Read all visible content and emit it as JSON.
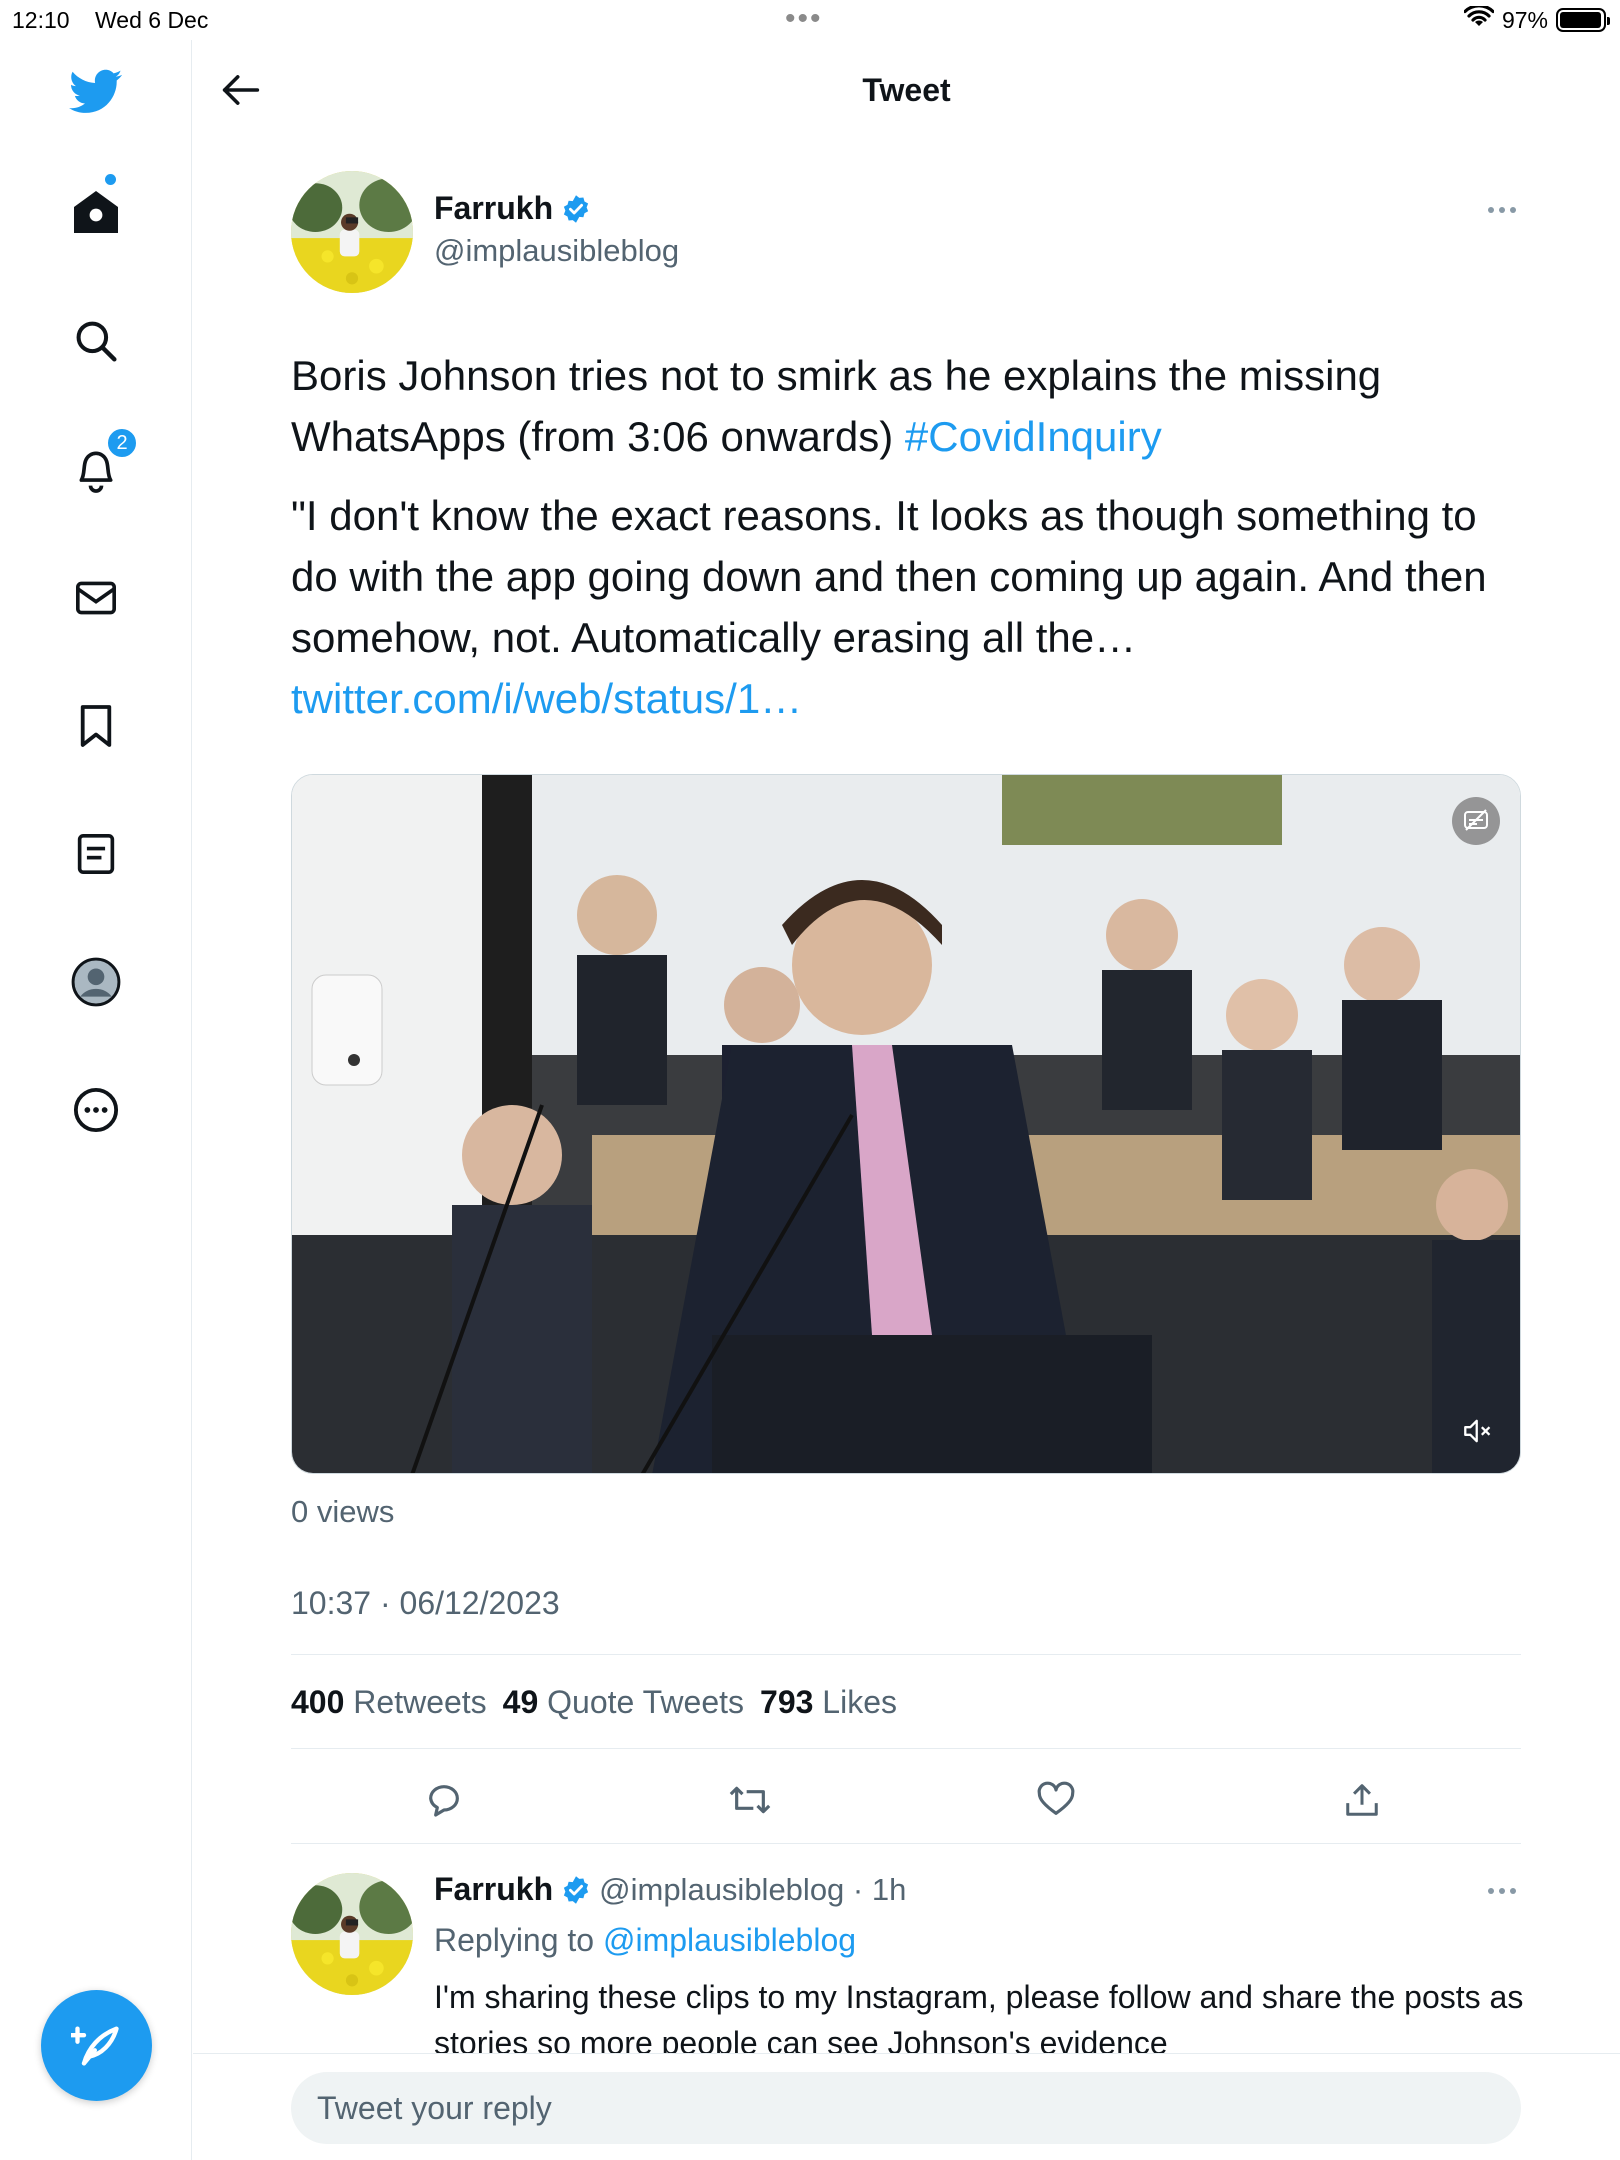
{
  "status_bar": {
    "time": "12:10",
    "date": "Wed 6 Dec",
    "battery": "97%",
    "battery_level": 0.97
  },
  "sidebar": {
    "items": [
      {
        "name": "home-icon"
      },
      {
        "name": "search-icon"
      },
      {
        "name": "notifications-icon",
        "badge": "2"
      },
      {
        "name": "messages-icon"
      },
      {
        "name": "bookmarks-icon"
      },
      {
        "name": "lists-icon"
      },
      {
        "name": "profile-icon"
      },
      {
        "name": "more-icon"
      }
    ],
    "accent": "#1d9bf0"
  },
  "header": {
    "title": "Tweet"
  },
  "tweet": {
    "author_name": "Farrukh",
    "author_handle": "@implausibleblog",
    "text_line1": "Boris Johnson tries not to smirk as he explains the missing WhatsApps (from 3:06 onwards) ",
    "hashtag": "#CovidInquiry",
    "quote": "\"I don't know the exact reasons. It looks as though something to do with the app going down and then coming up again. And then somehow, not. Automatically erasing all the… ",
    "link": "twitter.com/i/web/status/1…",
    "views": "0 views",
    "timestamp": "10:37 · 06/12/2023",
    "stats": {
      "retweets_count": "400",
      "retweets_label": "Retweets",
      "quotes_count": "49",
      "quotes_label": "Quote Tweets",
      "likes_count": "793",
      "likes_label": "Likes"
    }
  },
  "reply": {
    "author_name": "Farrukh",
    "meta": "@implausibleblog · 1h",
    "replying_prefix": "Replying to ",
    "replying_to": "@implausibleblog",
    "text": "I'm sharing these clips to my Instagram, please follow and share the posts as stories so more people can see Johnson's evidence"
  },
  "reply_box": {
    "placeholder": "Tweet your reply"
  }
}
